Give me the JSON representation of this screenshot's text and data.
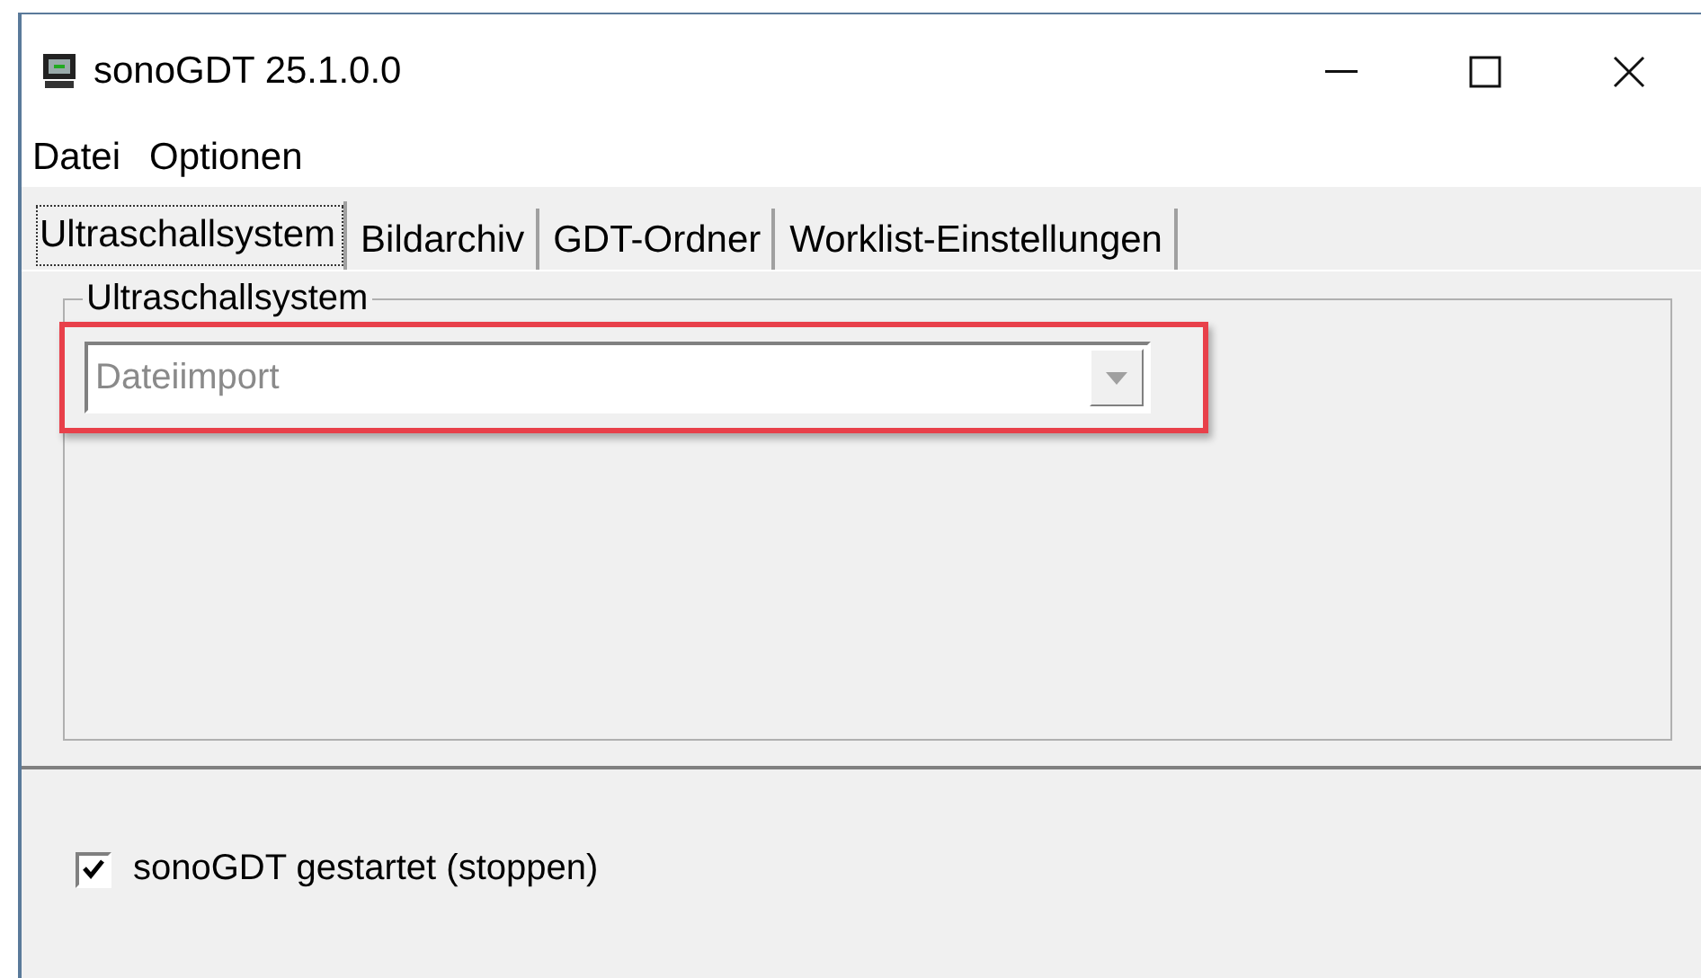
{
  "window": {
    "title": "sonoGDT 25.1.0.0"
  },
  "menu": [
    "Datei",
    "Optionen"
  ],
  "tabs": [
    {
      "label": "Ultraschallsystem",
      "selected": true
    },
    {
      "label": "Bildarchiv",
      "selected": false
    },
    {
      "label": "GDT-Ordner",
      "selected": false
    },
    {
      "label": "Worklist-Einstellungen",
      "selected": false
    }
  ],
  "group": {
    "title": "Ultraschallsystem",
    "dropdown": {
      "value": "Dateiimport",
      "disabled": true,
      "highlighted": true
    }
  },
  "checkbox": {
    "label": "sonoGDT gestartet (stoppen)",
    "checked": true
  }
}
